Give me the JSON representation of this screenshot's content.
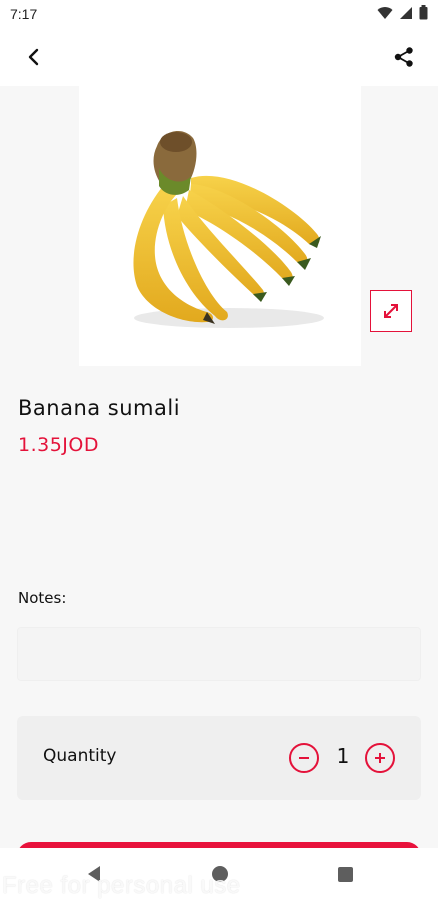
{
  "status_bar": {
    "time": "7:17",
    "icons": [
      "wifi-icon",
      "signal-icon",
      "battery-icon"
    ]
  },
  "app_bar": {
    "back_icon": "chevron-left-icon",
    "share_icon": "share-icon"
  },
  "product": {
    "name": "Banana sumali",
    "price": "1.35JOD",
    "image": "banana-bunch",
    "expand_icon": "expand-icon"
  },
  "notes": {
    "label": "Notes:",
    "value": "",
    "placeholder": ""
  },
  "quantity": {
    "label": "Quantity",
    "value": "1",
    "minus_icon": "minus-circle-icon",
    "plus_icon": "plus-circle-icon"
  },
  "watermark": "Free for personal use",
  "colors": {
    "accent": "#e4123a",
    "background": "#f7f7f7",
    "card": "#efefef",
    "banana": "#f2c233"
  },
  "nav_bar": {
    "icons": [
      "nav-back-icon",
      "nav-home-icon",
      "nav-recents-icon"
    ]
  }
}
